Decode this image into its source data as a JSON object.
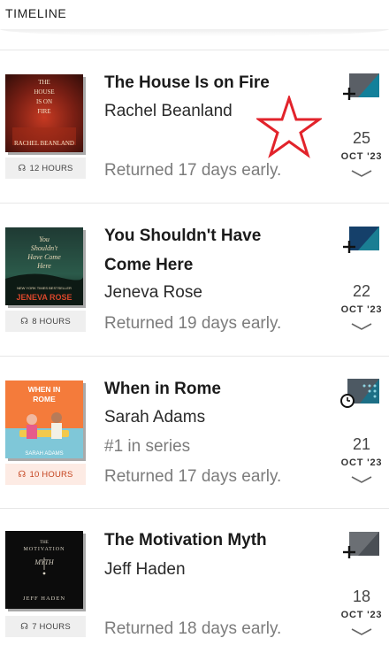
{
  "header": {
    "title": "TIMELINE"
  },
  "books": [
    {
      "title": "The House Is on Fire",
      "author": "Rachel Beanland",
      "series": "",
      "status": "Returned 17 days early.",
      "hours": "12 HOURS",
      "hours_highlight": false,
      "format_icon": "audiobook-add-icon",
      "date_day": "25",
      "date_month": "OCT '23",
      "cover": {
        "line1": "THE",
        "line2": "HOUSE",
        "line3": "IS ON",
        "line4": "FIRE",
        "author": "RACHEL BEANLAND"
      }
    },
    {
      "title": "You Shouldn't Have Come Here",
      "author": "Jeneva Rose",
      "series": "",
      "status": "Returned 19 days early.",
      "hours": "8 HOURS",
      "hours_highlight": false,
      "format_icon": "audiobook-add-icon",
      "date_day": "22",
      "date_month": "OCT '23",
      "cover": {
        "line1": "You",
        "line2": "Shouldn't",
        "line3": "Have Come",
        "line4": "Here",
        "badge": "NEW YORK TIMES BESTSELLER",
        "author": "JENEVA ROSE"
      }
    },
    {
      "title": "When in Rome",
      "author": "Sarah Adams",
      "series": "#1 in series",
      "status": "Returned 17 days early.",
      "hours": "10 HOURS",
      "hours_highlight": true,
      "format_icon": "audiobook-timer-icon",
      "date_day": "21",
      "date_month": "OCT '23",
      "cover": {
        "line1": "WHEN IN",
        "line2": "ROME",
        "author": "SARAH ADAMS"
      }
    },
    {
      "title": "The Motivation Myth",
      "author": "Jeff Haden",
      "series": "",
      "status": "Returned 18 days early.",
      "hours": "7 HOURS",
      "hours_highlight": false,
      "format_icon": "audiobook-add-icon",
      "date_day": "18",
      "date_month": "OCT '23",
      "cover": {
        "line1": "THE",
        "line2": "MOTIVATION",
        "line3": "MYTH",
        "author": "JEFF HADEN"
      }
    }
  ],
  "icons": {
    "hours_icon": "headphones-icon",
    "chevron": "chevron-down-icon",
    "annotation": "red-star-outline"
  },
  "colors": {
    "star": "#e2232b",
    "highlight_bg": "#fdebe4",
    "highlight_text": "#c4431e"
  }
}
